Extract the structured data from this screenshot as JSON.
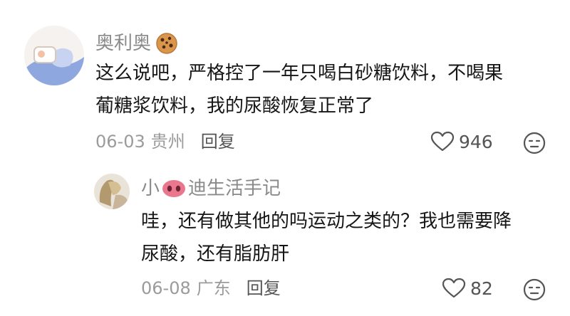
{
  "comments": [
    {
      "username": "奥利奥",
      "emoji": "cookie-emoji",
      "text_lines": [
        "这么说吧，严格控了一年只喝白砂糖饮料，不喝果",
        "葡糖浆饮料，我的尿酸恢复正常了"
      ],
      "date": "06-03",
      "location": "贵州",
      "reply_label": "回复",
      "like_count": "946"
    },
    {
      "username_prefix": "小",
      "emoji": "pig-nose-emoji",
      "username_suffix": "迪生活手记",
      "text_lines": [
        "哇，还有做其他的吗运动之类的？我也需要降",
        "尿酸，还有脂肪肝"
      ],
      "date": "06-08",
      "location": "广东",
      "reply_label": "回复",
      "like_count": "82"
    }
  ],
  "icons": {
    "like": "heart-outline-icon",
    "reaction": "neutral-face-icon"
  },
  "colors": {
    "username": "#8a8a8a",
    "text": "#161616",
    "meta": "#9b9b9b",
    "pig": "#e9788f"
  }
}
